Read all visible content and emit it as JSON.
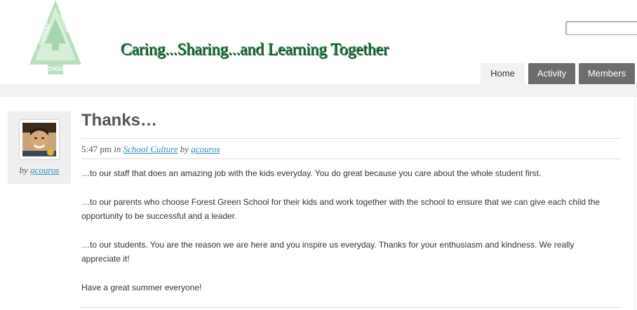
{
  "header": {
    "logo_text_top": "FOREST",
    "logo_text_right": "GREEN",
    "logo_text_bottom": "SCHOOL",
    "tagline": "Caring...Sharing...and Learning Together",
    "search": {
      "value": "",
      "placeholder": ""
    }
  },
  "nav": {
    "tabs": [
      {
        "label": "Home",
        "active": true
      },
      {
        "label": "Activity",
        "active": false
      },
      {
        "label": "Members",
        "active": false
      }
    ]
  },
  "post": {
    "author_prefix": "by",
    "author": "gcouros",
    "title": "Thanks…",
    "time": "5:47 pm",
    "in_word": "in",
    "category": "School Culture",
    "by_word": "by",
    "meta_author": "gcouros",
    "paragraphs": [
      "…to our staff that does an amazing job with the kids everyday.  You do great because you care about the whole student first.",
      "…to our parents who choose Forest Green School for their kids and work together with the school to ensure that we can give each child the opportunity to be successful and a leader.",
      "…to our students.  You are the reason we are here and you inspire us everyday.  Thanks for your enthusiasm and kindness.  We really appreciate it!",
      "Have a great summer everyone!"
    ]
  },
  "colors": {
    "logo_green": "#b9dfbe",
    "tagline_green": "#1f6b3a",
    "nav_tab": "#6d6d6d",
    "nav_active": "#f2f2f2",
    "link": "#2a8fb8"
  }
}
